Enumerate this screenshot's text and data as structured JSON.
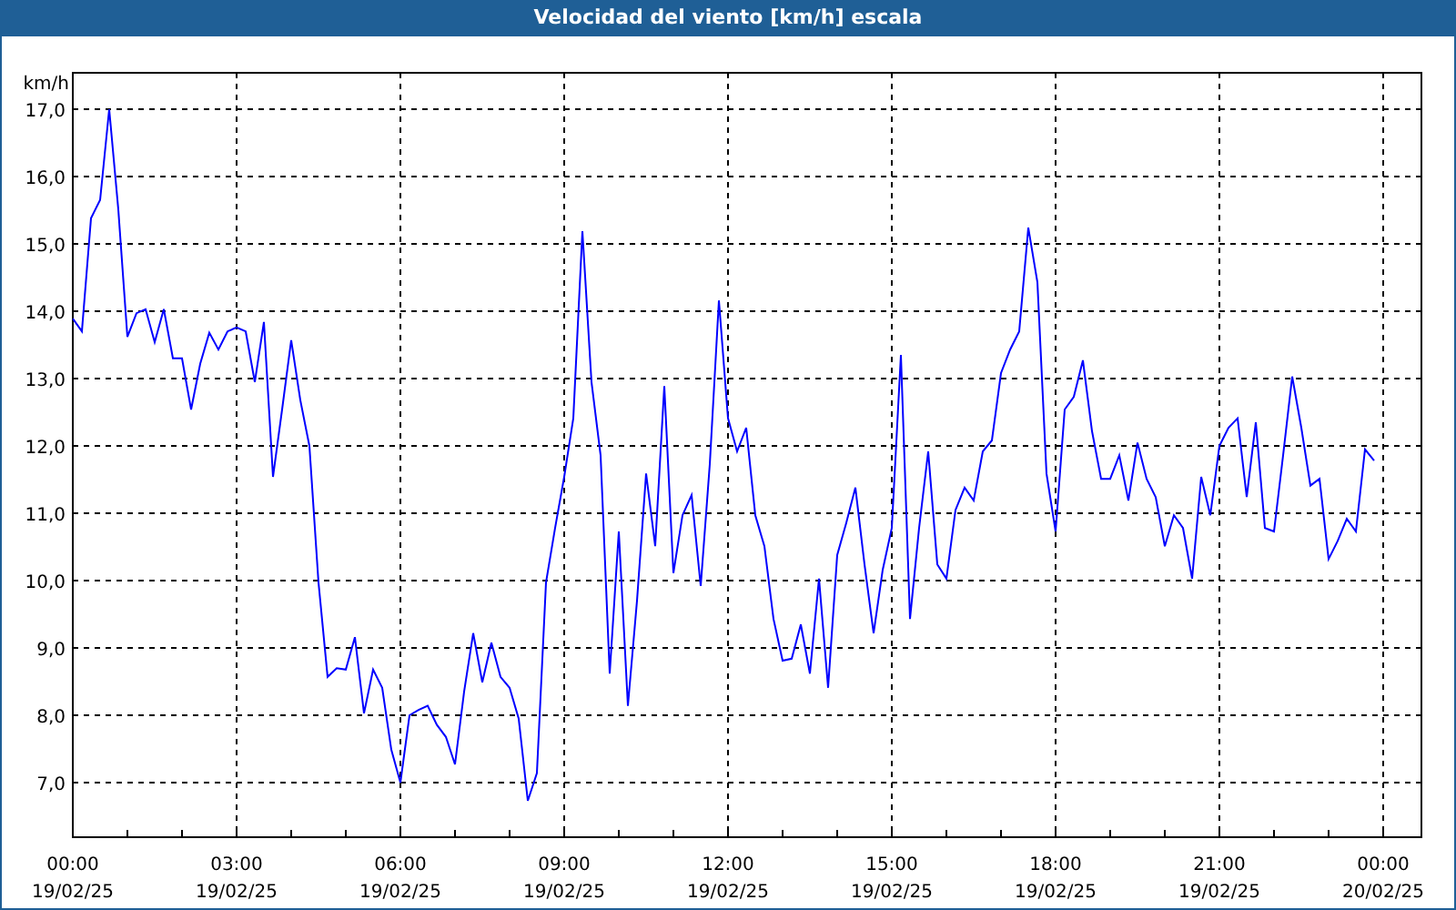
{
  "window": {
    "title": "Velocidad del viento [km/h] escala"
  },
  "chart": {
    "chart_data": {
      "type": "line",
      "ylabel": "km/h",
      "categories": [
        "00:00 19/02/25",
        null,
        null,
        null,
        null,
        null,
        null,
        null,
        null,
        null,
        null,
        null,
        null,
        null,
        null,
        null,
        null,
        null,
        "03:00 19/02/25",
        null,
        null,
        null,
        null,
        null,
        null,
        null,
        null,
        null,
        null,
        null,
        null,
        null,
        null,
        null,
        null,
        null,
        "06:00 19/02/25",
        null,
        null,
        null,
        null,
        null,
        null,
        null,
        null,
        null,
        null,
        null,
        null,
        null,
        null,
        null,
        null,
        null,
        "09:00 19/02/25",
        null,
        null,
        null,
        null,
        null,
        null,
        null,
        null,
        null,
        null,
        null,
        null,
        null,
        null,
        null,
        null,
        null,
        "12:00 19/02/25",
        null,
        null,
        null,
        null,
        null,
        null,
        null,
        null,
        null,
        null,
        null,
        null,
        null,
        null,
        null,
        null,
        null,
        "15:00 19/02/25",
        null,
        null,
        null,
        null,
        null,
        null,
        null,
        null,
        null,
        null,
        null,
        null,
        null,
        null,
        null,
        null,
        null,
        "18:00 19/02/25",
        null,
        null,
        null,
        null,
        null,
        null,
        null,
        null,
        null,
        null,
        null,
        null,
        null,
        null,
        null,
        null,
        null,
        "21:00 19/02/25",
        null,
        null,
        null,
        null,
        null,
        null,
        null,
        null,
        null,
        null,
        null,
        null,
        null,
        null,
        null,
        null,
        null,
        "00:00 20/02/25"
      ],
      "series": [
        {
          "color": "#0000ff",
          "values": [
            13.89,
            13.7,
            15.38,
            15.65,
            17.0,
            15.51,
            13.62,
            13.97,
            14.03,
            13.54,
            14.03,
            13.3,
            13.3,
            12.54,
            13.22,
            13.68,
            13.43,
            13.7,
            13.76,
            13.7,
            12.95,
            13.84,
            11.54,
            12.54,
            13.57,
            12.68,
            12.0,
            9.97,
            8.57,
            8.7,
            8.68,
            9.16,
            8.03,
            8.68,
            8.41,
            7.49,
            7.0,
            8.0,
            8.08,
            8.14,
            7.86,
            7.68,
            7.27,
            8.35,
            9.22,
            8.49,
            9.08,
            8.57,
            8.41,
            7.95,
            6.73,
            7.14,
            9.97,
            10.78,
            11.54,
            12.41,
            15.19,
            12.95,
            11.86,
            8.62,
            10.73,
            8.14,
            9.7,
            11.59,
            10.51,
            12.89,
            10.11,
            10.97,
            11.27,
            9.92,
            11.73,
            14.16,
            12.41,
            11.92,
            12.27,
            10.97,
            10.51,
            9.43,
            8.81,
            8.84,
            9.35,
            8.62,
            10.03,
            8.41,
            10.38,
            10.86,
            11.38,
            10.24,
            9.22,
            10.16,
            10.78,
            13.35,
            9.43,
            10.78,
            11.92,
            10.24,
            10.03,
            11.05,
            11.38,
            11.19,
            11.92,
            12.08,
            13.08,
            13.43,
            13.7,
            15.24,
            14.43,
            11.59,
            10.73,
            12.54,
            12.73,
            13.27,
            12.22,
            11.51,
            11.51,
            11.86,
            11.19,
            12.05,
            11.51,
            11.24,
            10.51,
            10.97,
            10.78,
            10.03,
            11.54,
            10.97,
            12.0,
            12.27,
            12.41,
            11.24,
            12.35,
            10.78,
            10.73,
            11.86,
            13.03,
            12.27,
            11.41,
            11.51,
            10.32,
            10.59,
            10.92,
            10.73,
            11.95,
            11.78,
            null
          ]
        }
      ],
      "grid": true,
      "ylim": [
        6.19,
        17.54
      ],
      "yticks": [
        {
          "value": 7,
          "label": "7,0"
        },
        {
          "value": 8,
          "label": "8,0"
        },
        {
          "value": 9,
          "label": "9,0"
        },
        {
          "value": 10,
          "label": "10,0"
        },
        {
          "value": 11,
          "label": "11,0"
        },
        {
          "value": 12,
          "label": "12,0"
        },
        {
          "value": 13,
          "label": "13,0"
        },
        {
          "value": 14,
          "label": "14,0"
        },
        {
          "value": 15,
          "label": "15,0"
        },
        {
          "value": 16,
          "label": "16,0"
        },
        {
          "value": 17,
          "label": "17,0"
        }
      ]
    }
  }
}
